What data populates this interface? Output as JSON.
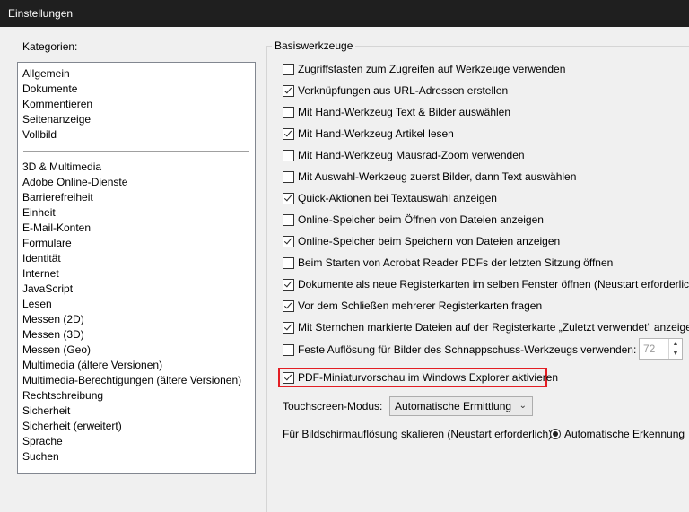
{
  "window": {
    "title": "Einstellungen"
  },
  "categories": {
    "heading": "Kategorien:",
    "group1": [
      "Allgemein",
      "Dokumente",
      "Kommentieren",
      "Seitenanzeige",
      "Vollbild"
    ],
    "group2": [
      "3D & Multimedia",
      "Adobe Online-Dienste",
      "Barrierefreiheit",
      "Einheit",
      "E-Mail-Konten",
      "Formulare",
      "Identität",
      "Internet",
      "JavaScript",
      "Lesen",
      "Messen (2D)",
      "Messen (3D)",
      "Messen (Geo)",
      "Multimedia (ältere Versionen)",
      "Multimedia-Berechtigungen (ältere Versionen)",
      "Rechtschreibung",
      "Sicherheit",
      "Sicherheit (erweitert)",
      "Sprache",
      "Suchen"
    ]
  },
  "basis": {
    "title": "Basiswerkzeuge",
    "options": [
      {
        "label": "Zugriffstasten zum Zugreifen auf Werkzeuge verwenden",
        "checked": false
      },
      {
        "label": "Verknüpfungen aus URL-Adressen erstellen",
        "checked": true
      },
      {
        "label": "Mit Hand-Werkzeug Text & Bilder auswählen",
        "checked": false
      },
      {
        "label": "Mit Hand-Werkzeug Artikel lesen",
        "checked": true
      },
      {
        "label": "Mit Hand-Werkzeug Mausrad-Zoom verwenden",
        "checked": false
      },
      {
        "label": "Mit Auswahl-Werkzeug zuerst Bilder, dann Text auswählen",
        "checked": false
      },
      {
        "label": "Quick-Aktionen bei Textauswahl anzeigen",
        "checked": true
      },
      {
        "label": "Online-Speicher beim Öffnen von Dateien anzeigen",
        "checked": false
      },
      {
        "label": "Online-Speicher beim Speichern von Dateien anzeigen",
        "checked": true
      },
      {
        "label": "Beim Starten von Acrobat Reader PDFs der letzten Sitzung öffnen",
        "checked": false
      },
      {
        "label": "Dokumente als neue Registerkarten im selben Fenster öffnen (Neustart erforderlich)",
        "checked": true
      },
      {
        "label": "Vor dem Schließen mehrerer Registerkarten fragen",
        "checked": true
      },
      {
        "label": "Mit Sternchen markierte Dateien auf der Registerkarte „Zuletzt verwendet“ anzeigen",
        "checked": true
      },
      {
        "label": "Feste Auflösung für Bilder des Schnappschuss-Werkzeugs verwenden:",
        "checked": false
      },
      {
        "label": "PDF-Miniaturvorschau im Windows Explorer aktivieren",
        "checked": true
      }
    ],
    "snapshot_resolution": "72",
    "touch_label": "Touchscreen-Modus:",
    "touch_value": "Automatische Ermittlung",
    "scale_label": "Für Bildschirmauflösung skalieren (Neustart erforderlich):",
    "scale_value": "Automatische Erkennung"
  },
  "colors": {
    "highlight": "#e31e24",
    "titlebar": "#1f1f1f"
  }
}
